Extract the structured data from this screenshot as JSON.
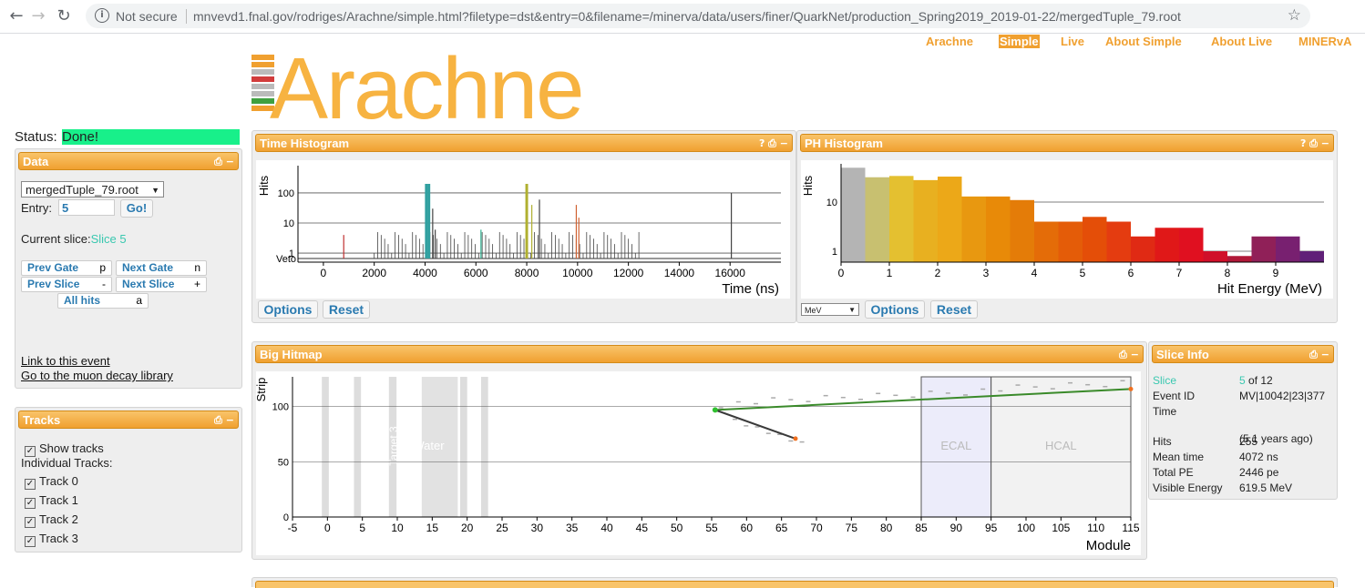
{
  "browser": {
    "security_label": "Not secure",
    "url": "mnvevd1.fnal.gov/rodriges/Arachne/simple.html?filetype=dst&entry=0&filename=/minerva/data/users/finer/QuarkNet/production_Spring2019_2019-01-22/mergedTuple_79.root",
    "back_icon": "←",
    "forward_icon": "→",
    "reload_icon": "↻",
    "star_icon": "☆",
    "info_icon": "i"
  },
  "nav": {
    "items": [
      "Arachne",
      "Simple",
      "Live",
      "About Simple",
      "About Live",
      "MINERvA"
    ],
    "active": "Simple"
  },
  "logo": {
    "text": "Arachne",
    "bar_colors": [
      "#f0a030",
      "#f0a030",
      "#bbbbbb",
      "#d23c3c",
      "#bbbbbb",
      "#bbbbbb",
      "#3fa040",
      "#f0a030"
    ]
  },
  "status": {
    "label": "Status:",
    "value": "Done!",
    "color": "#18f08a"
  },
  "data_panel": {
    "title": "Data",
    "file_select": "mergedTuple_79.root",
    "entry_label": "Entry:",
    "entry_value": "5",
    "go_label": "Go!",
    "current_slice_label": "Current slice:",
    "current_slice_value": "Slice 5",
    "buttons": [
      {
        "label": "Prev Gate",
        "key": "p"
      },
      {
        "label": "Next Gate",
        "key": "n"
      },
      {
        "label": "Prev Slice",
        "key": "-"
      },
      {
        "label": "Next Slice",
        "key": "+"
      },
      {
        "label": "All hits",
        "key": "a"
      }
    ],
    "link_event": "Link to this event",
    "link_muon": "Go to the muon decay library"
  },
  "tracks_panel": {
    "title": "Tracks",
    "show_tracks": "Show tracks",
    "individual_label": "Individual Tracks:",
    "tracks": [
      "Track 0",
      "Track 1",
      "Track 2",
      "Track 3"
    ]
  },
  "time_hist": {
    "title": "Time Histogram",
    "controls": "? ⎙ −",
    "options_label": "Options",
    "reset_label": "Reset"
  },
  "ph_hist": {
    "title": "PH Histogram",
    "controls": "? ⎙ −",
    "unit_select": "MeV",
    "options_label": "Options",
    "reset_label": "Reset"
  },
  "hitmap": {
    "title": "Big Hitmap",
    "controls": "⎙ −"
  },
  "slice_info": {
    "title": "Slice Info",
    "controls": "⎙ −",
    "rows": [
      {
        "label": "Slice",
        "value": "5",
        "suffix": " of 12"
      },
      {
        "label": "Event ID",
        "value": "MV|10042|23|377"
      },
      {
        "label": "Time",
        "value": ""
      },
      {
        "label": "",
        "value": "(5.1 years ago)"
      },
      {
        "label": "Hits",
        "value": "255"
      },
      {
        "label": "Mean time",
        "value": "4072 ns"
      },
      {
        "label": "Total PE",
        "value": "2446 pe"
      },
      {
        "label": "Visible Energy",
        "value": "619.5 MeV"
      }
    ]
  },
  "chart_data": [
    {
      "type": "bar",
      "title": "Time Histogram",
      "xlabel": "Time (ns)",
      "ylabel": "Hits",
      "log_y": true,
      "xlim": [
        -1000,
        18000
      ],
      "ylim": [
        0.5,
        200
      ],
      "xticks": [
        "0",
        "2000",
        "4000",
        "6000",
        "8000",
        "10000",
        "12000",
        "14000",
        "16000"
      ],
      "yticks": [
        "1",
        "10",
        "100"
      ],
      "extra_label": "Veto",
      "spikes": [
        {
          "t": 800,
          "h": 4,
          "color": "#c03030"
        },
        {
          "t": 4050,
          "h": 200,
          "color": "#30a0a0"
        },
        {
          "t": 4150,
          "h": 200,
          "color": "#30a0a0"
        },
        {
          "t": 4300,
          "h": 30,
          "color": "#444444"
        },
        {
          "t": 4400,
          "h": 6,
          "color": "#444444"
        },
        {
          "t": 6200,
          "h": 6,
          "color": "#30b090"
        },
        {
          "t": 8000,
          "h": 200,
          "color": "#b0b030"
        },
        {
          "t": 8200,
          "h": 40,
          "color": "#b0b030"
        },
        {
          "t": 8500,
          "h": 60,
          "color": "#444444"
        },
        {
          "t": 9950,
          "h": 40,
          "color": "#d06030"
        },
        {
          "t": 10050,
          "h": 15,
          "color": "#d06030"
        },
        {
          "t": 16050,
          "h": 100,
          "color": "#444444"
        }
      ]
    },
    {
      "type": "bar",
      "title": "PH Histogram",
      "xlabel": "Hit Energy (MeV)",
      "ylabel": "Hits",
      "log_y": true,
      "xlim": [
        0,
        10
      ],
      "ylim": [
        0.6,
        60
      ],
      "yticks": [
        "1",
        "10"
      ],
      "xticks": [
        "0",
        "1",
        "2",
        "3",
        "4",
        "5",
        "6",
        "7",
        "8",
        "9"
      ],
      "bins": [
        {
          "x": 0,
          "v": 50,
          "color": "#b4b4b4"
        },
        {
          "x": 0.5,
          "v": 32,
          "color": "#c8c070"
        },
        {
          "x": 1.0,
          "v": 34,
          "color": "#e4c030"
        },
        {
          "x": 1.5,
          "v": 28,
          "color": "#e8b020"
        },
        {
          "x": 2.0,
          "v": 33,
          "color": "#eca818"
        },
        {
          "x": 2.5,
          "v": 13,
          "color": "#e89810"
        },
        {
          "x": 3.0,
          "v": 13,
          "color": "#e88a08"
        },
        {
          "x": 3.5,
          "v": 11,
          "color": "#e47c08"
        },
        {
          "x": 4.0,
          "v": 4,
          "color": "#e46c08"
        },
        {
          "x": 4.5,
          "v": 4,
          "color": "#e45c08"
        },
        {
          "x": 5.0,
          "v": 5,
          "color": "#e44e08"
        },
        {
          "x": 5.5,
          "v": 4,
          "color": "#e43c10"
        },
        {
          "x": 6.0,
          "v": 2,
          "color": "#e02a14"
        },
        {
          "x": 6.5,
          "v": 3,
          "color": "#e01818"
        },
        {
          "x": 7.0,
          "v": 3,
          "color": "#e01020"
        },
        {
          "x": 7.5,
          "v": 1,
          "color": "#d0102a"
        },
        {
          "x": 8.0,
          "v": 0.8,
          "color": "#b01838"
        },
        {
          "x": 8.5,
          "v": 2,
          "color": "#902058"
        },
        {
          "x": 9.0,
          "v": 2,
          "color": "#782070"
        },
        {
          "x": 9.5,
          "v": 1,
          "color": "#602078"
        }
      ]
    },
    {
      "type": "scatter",
      "title": "Big Hitmap",
      "xlabel": "Module",
      "ylabel": "Strip",
      "xlim": [
        -5,
        115
      ],
      "ylim": [
        0,
        127
      ],
      "xticks": [
        "-5",
        "0",
        "5",
        "10",
        "15",
        "20",
        "25",
        "30",
        "35",
        "40",
        "45",
        "50",
        "55",
        "60",
        "65",
        "70",
        "75",
        "80",
        "85",
        "90",
        "95",
        "100",
        "105",
        "110",
        "115"
      ],
      "yticks": [
        "0",
        "50",
        "100"
      ],
      "regions": [
        {
          "name": "Water",
          "x0": 9.5,
          "x1": 12.5
        },
        {
          "name": "Target 3",
          "x0": 9.0,
          "x1": 10.0
        },
        {
          "name": "ECAL",
          "x0": 85,
          "x1": 95
        },
        {
          "name": "HCAL",
          "x0": 95,
          "x1": 115
        }
      ],
      "tracks": [
        {
          "name": "Track 0",
          "color": "#3a8a2a",
          "points": [
            [
              55.5,
              97
            ],
            [
              115,
              116
            ]
          ]
        },
        {
          "name": "Track 1",
          "color": "#3a3a3a",
          "points": [
            [
              55.5,
              97
            ],
            [
              67,
              71
            ]
          ]
        }
      ]
    }
  ]
}
